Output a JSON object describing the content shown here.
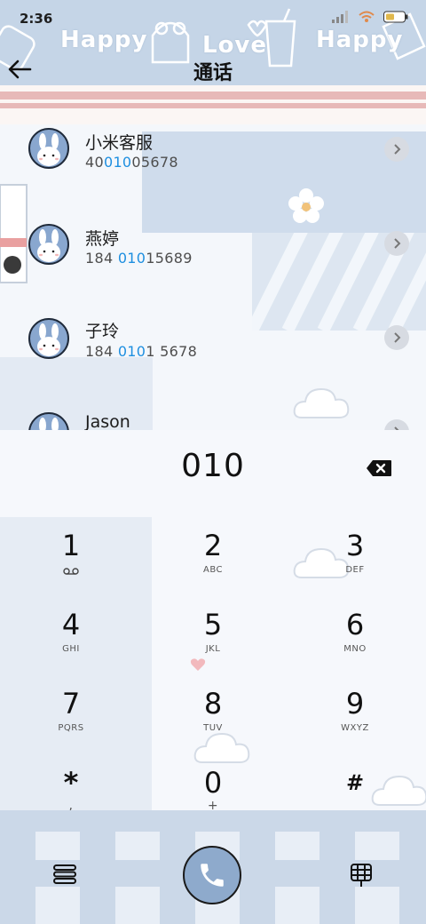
{
  "status_bar": {
    "time": "2:36"
  },
  "header": {
    "title": "通话",
    "deco_words": [
      "Happy",
      "Love",
      "Happy"
    ]
  },
  "contacts": [
    {
      "name": "小米客服",
      "number_parts": [
        "40",
        "010",
        "05678"
      ]
    },
    {
      "name": "燕婷",
      "number_parts": [
        "184 ",
        "010",
        "15689"
      ]
    },
    {
      "name": "子玲",
      "number_parts": [
        "184 ",
        "010",
        "1 5678"
      ]
    },
    {
      "name": "Jason",
      "number_parts": [
        "",
        "",
        ""
      ]
    }
  ],
  "dialer": {
    "input": "010",
    "keys": [
      {
        "digit": "1",
        "letters": "voicemail-icon"
      },
      {
        "digit": "2",
        "letters": "ABC"
      },
      {
        "digit": "3",
        "letters": "DEF"
      },
      {
        "digit": "4",
        "letters": "GHI"
      },
      {
        "digit": "5",
        "letters": "JKL"
      },
      {
        "digit": "6",
        "letters": "MNO"
      },
      {
        "digit": "7",
        "letters": "PQRS"
      },
      {
        "digit": "8",
        "letters": "TUV"
      },
      {
        "digit": "9",
        "letters": "WXYZ"
      },
      {
        "digit": "*",
        "letters": ","
      },
      {
        "digit": "0",
        "letters": "+"
      },
      {
        "digit": "#",
        "letters": ""
      }
    ]
  },
  "colors": {
    "highlight": "#1e8fe0",
    "accent_blue": "#c5d5e7",
    "stripe_pink": "#e7b9b8",
    "call_button": "#8eaacc"
  }
}
